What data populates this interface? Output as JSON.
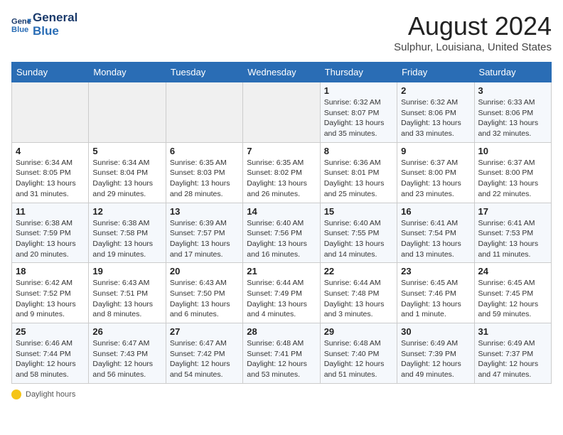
{
  "header": {
    "logo_line1": "General",
    "logo_line2": "Blue",
    "month_year": "August 2024",
    "location": "Sulphur, Louisiana, United States"
  },
  "days_of_week": [
    "Sunday",
    "Monday",
    "Tuesday",
    "Wednesday",
    "Thursday",
    "Friday",
    "Saturday"
  ],
  "weeks": [
    [
      {
        "day": "",
        "empty": true
      },
      {
        "day": "",
        "empty": true
      },
      {
        "day": "",
        "empty": true
      },
      {
        "day": "",
        "empty": true
      },
      {
        "day": "1",
        "sunrise": "6:32 AM",
        "sunset": "8:07 PM",
        "daylight": "13 hours and 35 minutes."
      },
      {
        "day": "2",
        "sunrise": "6:32 AM",
        "sunset": "8:06 PM",
        "daylight": "13 hours and 33 minutes."
      },
      {
        "day": "3",
        "sunrise": "6:33 AM",
        "sunset": "8:06 PM",
        "daylight": "13 hours and 32 minutes."
      }
    ],
    [
      {
        "day": "4",
        "sunrise": "6:34 AM",
        "sunset": "8:05 PM",
        "daylight": "13 hours and 31 minutes."
      },
      {
        "day": "5",
        "sunrise": "6:34 AM",
        "sunset": "8:04 PM",
        "daylight": "13 hours and 29 minutes."
      },
      {
        "day": "6",
        "sunrise": "6:35 AM",
        "sunset": "8:03 PM",
        "daylight": "13 hours and 28 minutes."
      },
      {
        "day": "7",
        "sunrise": "6:35 AM",
        "sunset": "8:02 PM",
        "daylight": "13 hours and 26 minutes."
      },
      {
        "day": "8",
        "sunrise": "6:36 AM",
        "sunset": "8:01 PM",
        "daylight": "13 hours and 25 minutes."
      },
      {
        "day": "9",
        "sunrise": "6:37 AM",
        "sunset": "8:00 PM",
        "daylight": "13 hours and 23 minutes."
      },
      {
        "day": "10",
        "sunrise": "6:37 AM",
        "sunset": "8:00 PM",
        "daylight": "13 hours and 22 minutes."
      }
    ],
    [
      {
        "day": "11",
        "sunrise": "6:38 AM",
        "sunset": "7:59 PM",
        "daylight": "13 hours and 20 minutes."
      },
      {
        "day": "12",
        "sunrise": "6:38 AM",
        "sunset": "7:58 PM",
        "daylight": "13 hours and 19 minutes."
      },
      {
        "day": "13",
        "sunrise": "6:39 AM",
        "sunset": "7:57 PM",
        "daylight": "13 hours and 17 minutes."
      },
      {
        "day": "14",
        "sunrise": "6:40 AM",
        "sunset": "7:56 PM",
        "daylight": "13 hours and 16 minutes."
      },
      {
        "day": "15",
        "sunrise": "6:40 AM",
        "sunset": "7:55 PM",
        "daylight": "13 hours and 14 minutes."
      },
      {
        "day": "16",
        "sunrise": "6:41 AM",
        "sunset": "7:54 PM",
        "daylight": "13 hours and 13 minutes."
      },
      {
        "day": "17",
        "sunrise": "6:41 AM",
        "sunset": "7:53 PM",
        "daylight": "13 hours and 11 minutes."
      }
    ],
    [
      {
        "day": "18",
        "sunrise": "6:42 AM",
        "sunset": "7:52 PM",
        "daylight": "13 hours and 9 minutes."
      },
      {
        "day": "19",
        "sunrise": "6:43 AM",
        "sunset": "7:51 PM",
        "daylight": "13 hours and 8 minutes."
      },
      {
        "day": "20",
        "sunrise": "6:43 AM",
        "sunset": "7:50 PM",
        "daylight": "13 hours and 6 minutes."
      },
      {
        "day": "21",
        "sunrise": "6:44 AM",
        "sunset": "7:49 PM",
        "daylight": "13 hours and 4 minutes."
      },
      {
        "day": "22",
        "sunrise": "6:44 AM",
        "sunset": "7:48 PM",
        "daylight": "13 hours and 3 minutes."
      },
      {
        "day": "23",
        "sunrise": "6:45 AM",
        "sunset": "7:46 PM",
        "daylight": "13 hours and 1 minute."
      },
      {
        "day": "24",
        "sunrise": "6:45 AM",
        "sunset": "7:45 PM",
        "daylight": "12 hours and 59 minutes."
      }
    ],
    [
      {
        "day": "25",
        "sunrise": "6:46 AM",
        "sunset": "7:44 PM",
        "daylight": "12 hours and 58 minutes."
      },
      {
        "day": "26",
        "sunrise": "6:47 AM",
        "sunset": "7:43 PM",
        "daylight": "12 hours and 56 minutes."
      },
      {
        "day": "27",
        "sunrise": "6:47 AM",
        "sunset": "7:42 PM",
        "daylight": "12 hours and 54 minutes."
      },
      {
        "day": "28",
        "sunrise": "6:48 AM",
        "sunset": "7:41 PM",
        "daylight": "12 hours and 53 minutes."
      },
      {
        "day": "29",
        "sunrise": "6:48 AM",
        "sunset": "7:40 PM",
        "daylight": "12 hours and 51 minutes."
      },
      {
        "day": "30",
        "sunrise": "6:49 AM",
        "sunset": "7:39 PM",
        "daylight": "12 hours and 49 minutes."
      },
      {
        "day": "31",
        "sunrise": "6:49 AM",
        "sunset": "7:37 PM",
        "daylight": "12 hours and 47 minutes."
      }
    ]
  ],
  "footer": {
    "daylight_label": "Daylight hours"
  }
}
